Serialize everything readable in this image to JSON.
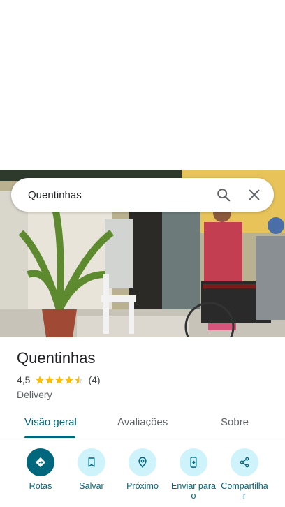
{
  "search": {
    "query": "Quentinhas"
  },
  "place": {
    "name": "Quentinhas",
    "rating": "4,5",
    "rating_value": 4.5,
    "review_count": "(4)",
    "category": "Delivery"
  },
  "tabs": [
    {
      "label": "Visão geral",
      "active": true
    },
    {
      "label": "Avaliações",
      "active": false
    },
    {
      "label": "Sobre",
      "active": false
    }
  ],
  "actions": [
    {
      "label": "Rotas",
      "icon": "directions-icon"
    },
    {
      "label": "Salvar",
      "icon": "bookmark-icon"
    },
    {
      "label": "Próximo",
      "icon": "nearby-icon"
    },
    {
      "label": "Enviar para o",
      "icon": "send-to-phone-icon"
    },
    {
      "label": "Compartilhar",
      "icon": "share-icon"
    }
  ],
  "colors": {
    "accent": "#00677d",
    "accent_light": "#cff3fb",
    "star": "#fbbc04"
  }
}
